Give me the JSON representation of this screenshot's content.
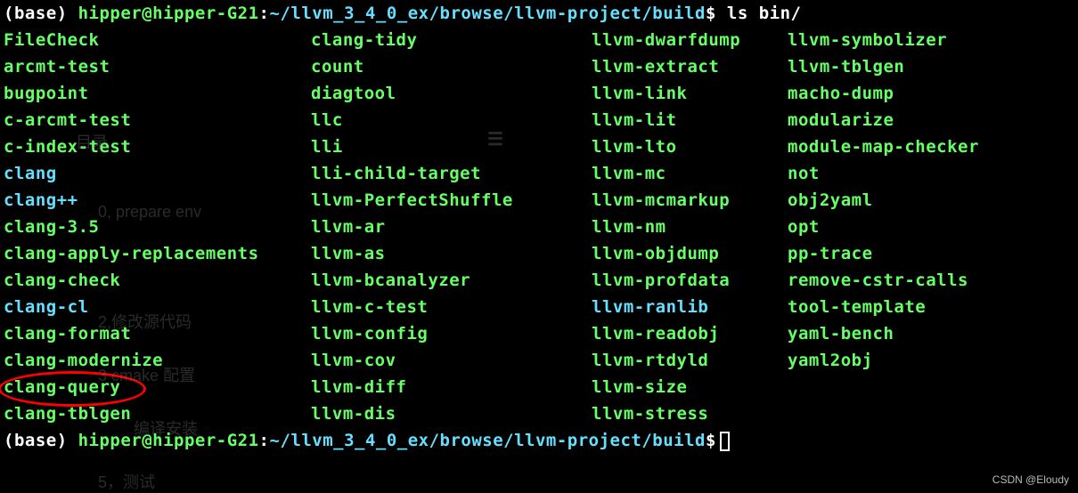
{
  "prompt": {
    "env": "(base) ",
    "userhost": "hipper@hipper-G21",
    "colon": ":",
    "path": "~/llvm_3_4_0_ex/browse/llvm-project/build",
    "dollar": "$",
    "command": "ls bin/"
  },
  "listing": {
    "col1": [
      {
        "name": "FileCheck",
        "type": "exe"
      },
      {
        "name": "arcmt-test",
        "type": "exe"
      },
      {
        "name": "bugpoint",
        "type": "exe"
      },
      {
        "name": "c-arcmt-test",
        "type": "exe"
      },
      {
        "name": "c-index-test",
        "type": "exe"
      },
      {
        "name": "clang",
        "type": "link"
      },
      {
        "name": "clang++",
        "type": "link"
      },
      {
        "name": "clang-3.5",
        "type": "exe"
      },
      {
        "name": "clang-apply-replacements",
        "type": "exe"
      },
      {
        "name": "clang-check",
        "type": "exe"
      },
      {
        "name": "clang-cl",
        "type": "link"
      },
      {
        "name": "clang-format",
        "type": "exe"
      },
      {
        "name": "clang-modernize",
        "type": "exe"
      },
      {
        "name": "clang-query",
        "type": "exe",
        "circled": true
      },
      {
        "name": "clang-tblgen",
        "type": "exe"
      }
    ],
    "col2": [
      {
        "name": "clang-tidy",
        "type": "exe"
      },
      {
        "name": "count",
        "type": "exe"
      },
      {
        "name": "diagtool",
        "type": "exe"
      },
      {
        "name": "llc",
        "type": "exe"
      },
      {
        "name": "lli",
        "type": "exe"
      },
      {
        "name": "lli-child-target",
        "type": "exe"
      },
      {
        "name": "llvm-PerfectShuffle",
        "type": "exe"
      },
      {
        "name": "llvm-ar",
        "type": "exe"
      },
      {
        "name": "llvm-as",
        "type": "exe"
      },
      {
        "name": "llvm-bcanalyzer",
        "type": "exe"
      },
      {
        "name": "llvm-c-test",
        "type": "exe"
      },
      {
        "name": "llvm-config",
        "type": "exe"
      },
      {
        "name": "llvm-cov",
        "type": "exe"
      },
      {
        "name": "llvm-diff",
        "type": "exe"
      },
      {
        "name": "llvm-dis",
        "type": "exe"
      }
    ],
    "col3": [
      {
        "name": "llvm-dwarfdump",
        "type": "exe"
      },
      {
        "name": "llvm-extract",
        "type": "exe"
      },
      {
        "name": "llvm-link",
        "type": "exe"
      },
      {
        "name": "llvm-lit",
        "type": "exe"
      },
      {
        "name": "llvm-lto",
        "type": "exe"
      },
      {
        "name": "llvm-mc",
        "type": "exe"
      },
      {
        "name": "llvm-mcmarkup",
        "type": "exe"
      },
      {
        "name": "llvm-nm",
        "type": "exe"
      },
      {
        "name": "llvm-objdump",
        "type": "exe"
      },
      {
        "name": "llvm-profdata",
        "type": "exe"
      },
      {
        "name": "llvm-ranlib",
        "type": "link"
      },
      {
        "name": "llvm-readobj",
        "type": "exe"
      },
      {
        "name": "llvm-rtdyld",
        "type": "exe"
      },
      {
        "name": "llvm-size",
        "type": "exe"
      },
      {
        "name": "llvm-stress",
        "type": "exe"
      }
    ],
    "col4": [
      {
        "name": "llvm-symbolizer",
        "type": "exe"
      },
      {
        "name": "llvm-tblgen",
        "type": "exe"
      },
      {
        "name": "macho-dump",
        "type": "exe"
      },
      {
        "name": "modularize",
        "type": "exe"
      },
      {
        "name": "module-map-checker",
        "type": "exe"
      },
      {
        "name": "not",
        "type": "exe"
      },
      {
        "name": "obj2yaml",
        "type": "exe"
      },
      {
        "name": "opt",
        "type": "exe"
      },
      {
        "name": "pp-trace",
        "type": "exe"
      },
      {
        "name": "remove-cstr-calls",
        "type": "exe"
      },
      {
        "name": "tool-template",
        "type": "exe"
      },
      {
        "name": "yaml-bench",
        "type": "exe"
      },
      {
        "name": "yaml2obj",
        "type": "exe"
      }
    ]
  },
  "ghost_text": {
    "g1": "目录",
    "g2": "0, prepare env",
    "g3": "2,修改源代码",
    "g4": "3 cmake 配置",
    "g5": "编译安装",
    "g6": "5，测试"
  },
  "watermark": "CSDN @Eloudy"
}
